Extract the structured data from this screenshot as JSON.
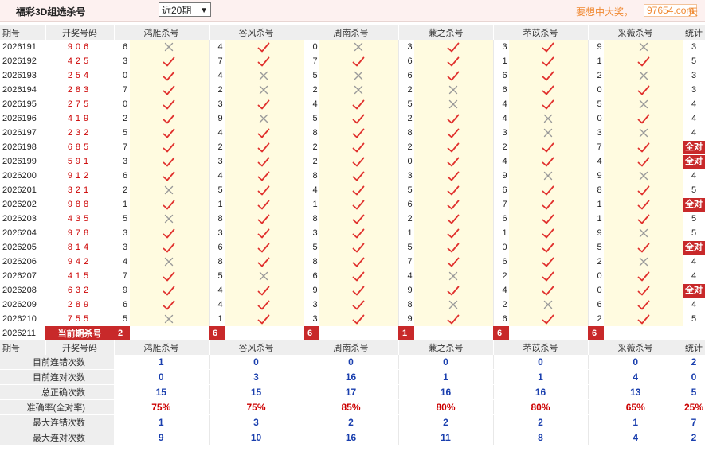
{
  "header": {
    "title": "福彩3D组选杀号",
    "period_select": "近20期",
    "slogan": "要想中大奖，",
    "site": "97654.com",
    "site_suffix": "天"
  },
  "columns": {
    "period": "期号",
    "winning": "开奖号码",
    "methods": [
      "鸿雁杀号",
      "谷风杀号",
      "周南杀号",
      "蒹之杀号",
      "芣苡杀号",
      "采薇杀号"
    ],
    "stats": "统计"
  },
  "rows": [
    {
      "period": "2026191",
      "win": "906",
      "kills": [
        [
          6,
          "x"
        ],
        [
          4,
          "v"
        ],
        [
          0,
          "x"
        ],
        [
          3,
          "v"
        ],
        [
          3,
          "v"
        ],
        [
          9,
          "x"
        ]
      ],
      "stat": "3"
    },
    {
      "period": "2026192",
      "win": "425",
      "kills": [
        [
          3,
          "v"
        ],
        [
          7,
          "v"
        ],
        [
          7,
          "v"
        ],
        [
          6,
          "v"
        ],
        [
          1,
          "v"
        ],
        [
          1,
          "v"
        ]
      ],
      "stat": "5"
    },
    {
      "period": "2026193",
      "win": "254",
      "kills": [
        [
          0,
          "v"
        ],
        [
          4,
          "x"
        ],
        [
          5,
          "x"
        ],
        [
          6,
          "v"
        ],
        [
          6,
          "v"
        ],
        [
          2,
          "x"
        ]
      ],
      "stat": "3"
    },
    {
      "period": "2026194",
      "win": "283",
      "kills": [
        [
          7,
          "v"
        ],
        [
          2,
          "x"
        ],
        [
          2,
          "x"
        ],
        [
          2,
          "x"
        ],
        [
          6,
          "v"
        ],
        [
          0,
          "v"
        ]
      ],
      "stat": "3"
    },
    {
      "period": "2026195",
      "win": "275",
      "kills": [
        [
          0,
          "v"
        ],
        [
          3,
          "v"
        ],
        [
          4,
          "v"
        ],
        [
          5,
          "x"
        ],
        [
          4,
          "v"
        ],
        [
          5,
          "x"
        ]
      ],
      "stat": "4"
    },
    {
      "period": "2026196",
      "win": "419",
      "kills": [
        [
          2,
          "v"
        ],
        [
          9,
          "x"
        ],
        [
          5,
          "v"
        ],
        [
          2,
          "v"
        ],
        [
          4,
          "x"
        ],
        [
          0,
          "v"
        ]
      ],
      "stat": "4"
    },
    {
      "period": "2026197",
      "win": "232",
      "kills": [
        [
          5,
          "v"
        ],
        [
          4,
          "v"
        ],
        [
          8,
          "v"
        ],
        [
          8,
          "v"
        ],
        [
          3,
          "x"
        ],
        [
          3,
          "x"
        ]
      ],
      "stat": "4"
    },
    {
      "period": "2026198",
      "win": "685",
      "kills": [
        [
          7,
          "v"
        ],
        [
          2,
          "v"
        ],
        [
          2,
          "v"
        ],
        [
          2,
          "v"
        ],
        [
          2,
          "v"
        ],
        [
          7,
          "v"
        ]
      ],
      "stat": "全对"
    },
    {
      "period": "2026199",
      "win": "591",
      "kills": [
        [
          3,
          "v"
        ],
        [
          3,
          "v"
        ],
        [
          2,
          "v"
        ],
        [
          0,
          "v"
        ],
        [
          4,
          "v"
        ],
        [
          4,
          "v"
        ]
      ],
      "stat": "全对"
    },
    {
      "period": "2026200",
      "win": "912",
      "kills": [
        [
          6,
          "v"
        ],
        [
          4,
          "v"
        ],
        [
          8,
          "v"
        ],
        [
          3,
          "v"
        ],
        [
          9,
          "x"
        ],
        [
          9,
          "x"
        ]
      ],
      "stat": "4"
    },
    {
      "period": "2026201",
      "win": "321",
      "kills": [
        [
          2,
          "x"
        ],
        [
          5,
          "v"
        ],
        [
          4,
          "v"
        ],
        [
          5,
          "v"
        ],
        [
          6,
          "v"
        ],
        [
          8,
          "v"
        ]
      ],
      "stat": "5"
    },
    {
      "period": "2026202",
      "win": "988",
      "kills": [
        [
          1,
          "v"
        ],
        [
          1,
          "v"
        ],
        [
          1,
          "v"
        ],
        [
          6,
          "v"
        ],
        [
          7,
          "v"
        ],
        [
          1,
          "v"
        ]
      ],
      "stat": "全对"
    },
    {
      "period": "2026203",
      "win": "435",
      "kills": [
        [
          5,
          "x"
        ],
        [
          8,
          "v"
        ],
        [
          8,
          "v"
        ],
        [
          2,
          "v"
        ],
        [
          6,
          "v"
        ],
        [
          1,
          "v"
        ]
      ],
      "stat": "5"
    },
    {
      "period": "2026204",
      "win": "978",
      "kills": [
        [
          3,
          "v"
        ],
        [
          3,
          "v"
        ],
        [
          3,
          "v"
        ],
        [
          1,
          "v"
        ],
        [
          1,
          "v"
        ],
        [
          9,
          "x"
        ]
      ],
      "stat": "5"
    },
    {
      "period": "2026205",
      "win": "814",
      "kills": [
        [
          3,
          "v"
        ],
        [
          6,
          "v"
        ],
        [
          5,
          "v"
        ],
        [
          5,
          "v"
        ],
        [
          0,
          "v"
        ],
        [
          5,
          "v"
        ]
      ],
      "stat": "全对"
    },
    {
      "period": "2026206",
      "win": "942",
      "kills": [
        [
          4,
          "x"
        ],
        [
          8,
          "v"
        ],
        [
          8,
          "v"
        ],
        [
          7,
          "v"
        ],
        [
          6,
          "v"
        ],
        [
          2,
          "x"
        ]
      ],
      "stat": "4"
    },
    {
      "period": "2026207",
      "win": "415",
      "kills": [
        [
          7,
          "v"
        ],
        [
          5,
          "x"
        ],
        [
          6,
          "v"
        ],
        [
          4,
          "x"
        ],
        [
          2,
          "v"
        ],
        [
          0,
          "v"
        ]
      ],
      "stat": "4"
    },
    {
      "period": "2026208",
      "win": "632",
      "kills": [
        [
          9,
          "v"
        ],
        [
          4,
          "v"
        ],
        [
          9,
          "v"
        ],
        [
          9,
          "v"
        ],
        [
          4,
          "v"
        ],
        [
          0,
          "v"
        ]
      ],
      "stat": "全对"
    },
    {
      "period": "2026209",
      "win": "289",
      "kills": [
        [
          6,
          "v"
        ],
        [
          4,
          "v"
        ],
        [
          3,
          "v"
        ],
        [
          8,
          "x"
        ],
        [
          2,
          "x"
        ],
        [
          6,
          "v"
        ]
      ],
      "stat": "4"
    },
    {
      "period": "2026210",
      "win": "755",
      "kills": [
        [
          5,
          "x"
        ],
        [
          1,
          "v"
        ],
        [
          3,
          "v"
        ],
        [
          9,
          "v"
        ],
        [
          6,
          "v"
        ],
        [
          2,
          "v"
        ]
      ],
      "stat": "5"
    }
  ],
  "current": {
    "period": "2026211",
    "label": "当前期杀号",
    "kills": [
      "2",
      "6",
      "6",
      "1",
      "6",
      "6"
    ]
  },
  "stats_rows": [
    {
      "label": "目前连错次数",
      "values": [
        "1",
        "0",
        "0",
        "0",
        "0",
        "0"
      ],
      "total": "2",
      "color": "blue"
    },
    {
      "label": "目前连对次数",
      "values": [
        "0",
        "3",
        "16",
        "1",
        "1",
        "4"
      ],
      "total": "0",
      "color": "blue"
    },
    {
      "label": "总正确次数",
      "values": [
        "15",
        "15",
        "17",
        "16",
        "16",
        "13"
      ],
      "total": "5",
      "color": "blue"
    },
    {
      "label": "准确率(全对率)",
      "values": [
        "75%",
        "75%",
        "85%",
        "80%",
        "80%",
        "65%"
      ],
      "total": "25%",
      "color": "red"
    },
    {
      "label": "最大连错次数",
      "values": [
        "1",
        "3",
        "2",
        "2",
        "2",
        "1"
      ],
      "total": "7",
      "color": "blue"
    },
    {
      "label": "最大连对次数",
      "values": [
        "9",
        "10",
        "16",
        "11",
        "8",
        "4"
      ],
      "total": "2",
      "color": "blue"
    }
  ],
  "colors": {
    "accent_red": "#c8292a",
    "stat_blue": "#1a3fae",
    "check_red": "#e0302d",
    "cross_grey": "#9a9a9a"
  }
}
